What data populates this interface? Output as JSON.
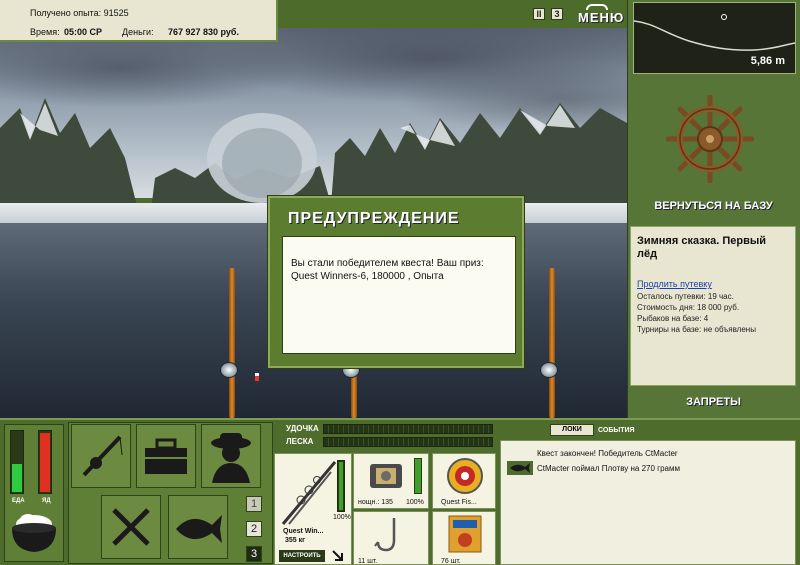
{
  "top_info": {
    "exp_label": "Получено опыта:",
    "exp_value": "91525",
    "time_label": "Время:",
    "time_value": "05:00 СР",
    "money_label": "Деньги:",
    "money_value": "767 927 830 руб."
  },
  "controls": {
    "pause_label": "II",
    "sound_label": "3",
    "menu_label": "МЕНЮ"
  },
  "depth": {
    "value": "5,86 m"
  },
  "base": {
    "return_label": "ВЕРНУТЬСЯ НА БАЗУ",
    "title": "Зимняя сказка. Первый лёд",
    "extend_link": "Продлить путевку",
    "remaining": "Осталось путевки: 19 час.",
    "day_cost": "Стоимость дня: 18 000 руб.",
    "fishers": "Рыбаков на базе: 4",
    "tournaments": "Турниры на базе: не объявлены",
    "bans_label": "ЗАПРЕТЫ"
  },
  "dialog": {
    "title": "ПРЕДУПРЕЖДЕНИЕ",
    "message": "Вы стали победителем квеста! Ваш приз: Quest Winners-6, 180000 , Опыта"
  },
  "bars": {
    "food_label": "ЕДА",
    "poison_label": "ЯД",
    "food_level": 0.45,
    "poison_level": 0.95
  },
  "slots": {
    "numbers": [
      "1",
      "2",
      "3"
    ]
  },
  "gear": {
    "rod_label": "УДОЧКА",
    "line_label": "ЛЕСКА",
    "rod_name": "Quest Win...",
    "rod_weight": "355 кг",
    "rod_condition": "100%",
    "setup_label": "НАСТРОИТЬ",
    "reel_caption": "нощн.: 135",
    "reel_condition": "100%",
    "line_caption": "Quest Fis...",
    "hook_caption": "11 шт.",
    "bait_caption": "76 шт."
  },
  "events": {
    "tab_label": "ЛОКИ",
    "tab_events": "СОБЫТИЯ",
    "lines": [
      "Квест закончен! Победитель CtMacter",
      "CtMacter поймал Плотву на 270 грамм"
    ]
  },
  "colors": {
    "panel_green": "#4e6c2c",
    "food_bar": "#2ecc40",
    "poison_bar": "#e03020"
  }
}
